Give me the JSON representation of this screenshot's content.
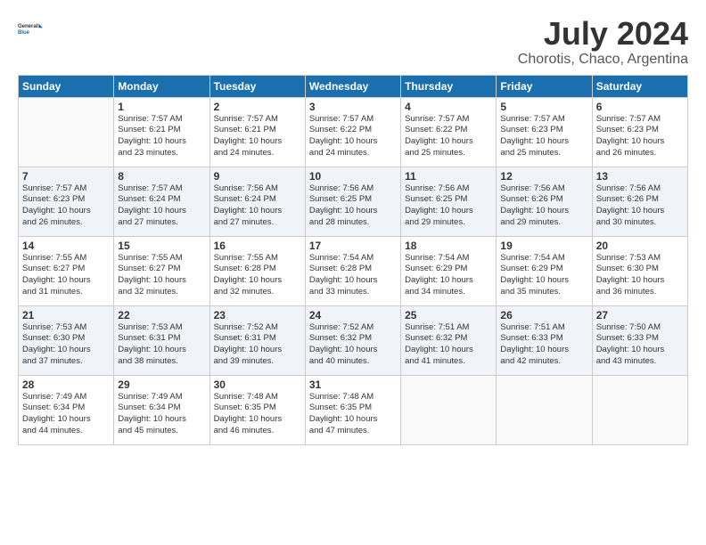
{
  "logo": {
    "line1": "General",
    "line2": "Blue"
  },
  "title": "July 2024",
  "subtitle": "Chorotis, Chaco, Argentina",
  "days_header": [
    "Sunday",
    "Monday",
    "Tuesday",
    "Wednesday",
    "Thursday",
    "Friday",
    "Saturday"
  ],
  "weeks": [
    [
      {
        "day": "",
        "sunrise": "",
        "sunset": "",
        "daylight": ""
      },
      {
        "day": "1",
        "sunrise": "Sunrise: 7:57 AM",
        "sunset": "Sunset: 6:21 PM",
        "daylight": "Daylight: 10 hours and 23 minutes."
      },
      {
        "day": "2",
        "sunrise": "Sunrise: 7:57 AM",
        "sunset": "Sunset: 6:21 PM",
        "daylight": "Daylight: 10 hours and 24 minutes."
      },
      {
        "day": "3",
        "sunrise": "Sunrise: 7:57 AM",
        "sunset": "Sunset: 6:22 PM",
        "daylight": "Daylight: 10 hours and 24 minutes."
      },
      {
        "day": "4",
        "sunrise": "Sunrise: 7:57 AM",
        "sunset": "Sunset: 6:22 PM",
        "daylight": "Daylight: 10 hours and 25 minutes."
      },
      {
        "day": "5",
        "sunrise": "Sunrise: 7:57 AM",
        "sunset": "Sunset: 6:23 PM",
        "daylight": "Daylight: 10 hours and 25 minutes."
      },
      {
        "day": "6",
        "sunrise": "Sunrise: 7:57 AM",
        "sunset": "Sunset: 6:23 PM",
        "daylight": "Daylight: 10 hours and 26 minutes."
      }
    ],
    [
      {
        "day": "7",
        "sunrise": "Sunrise: 7:57 AM",
        "sunset": "Sunset: 6:23 PM",
        "daylight": "Daylight: 10 hours and 26 minutes."
      },
      {
        "day": "8",
        "sunrise": "Sunrise: 7:57 AM",
        "sunset": "Sunset: 6:24 PM",
        "daylight": "Daylight: 10 hours and 27 minutes."
      },
      {
        "day": "9",
        "sunrise": "Sunrise: 7:56 AM",
        "sunset": "Sunset: 6:24 PM",
        "daylight": "Daylight: 10 hours and 27 minutes."
      },
      {
        "day": "10",
        "sunrise": "Sunrise: 7:56 AM",
        "sunset": "Sunset: 6:25 PM",
        "daylight": "Daylight: 10 hours and 28 minutes."
      },
      {
        "day": "11",
        "sunrise": "Sunrise: 7:56 AM",
        "sunset": "Sunset: 6:25 PM",
        "daylight": "Daylight: 10 hours and 29 minutes."
      },
      {
        "day": "12",
        "sunrise": "Sunrise: 7:56 AM",
        "sunset": "Sunset: 6:26 PM",
        "daylight": "Daylight: 10 hours and 29 minutes."
      },
      {
        "day": "13",
        "sunrise": "Sunrise: 7:56 AM",
        "sunset": "Sunset: 6:26 PM",
        "daylight": "Daylight: 10 hours and 30 minutes."
      }
    ],
    [
      {
        "day": "14",
        "sunrise": "Sunrise: 7:55 AM",
        "sunset": "Sunset: 6:27 PM",
        "daylight": "Daylight: 10 hours and 31 minutes."
      },
      {
        "day": "15",
        "sunrise": "Sunrise: 7:55 AM",
        "sunset": "Sunset: 6:27 PM",
        "daylight": "Daylight: 10 hours and 32 minutes."
      },
      {
        "day": "16",
        "sunrise": "Sunrise: 7:55 AM",
        "sunset": "Sunset: 6:28 PM",
        "daylight": "Daylight: 10 hours and 32 minutes."
      },
      {
        "day": "17",
        "sunrise": "Sunrise: 7:54 AM",
        "sunset": "Sunset: 6:28 PM",
        "daylight": "Daylight: 10 hours and 33 minutes."
      },
      {
        "day": "18",
        "sunrise": "Sunrise: 7:54 AM",
        "sunset": "Sunset: 6:29 PM",
        "daylight": "Daylight: 10 hours and 34 minutes."
      },
      {
        "day": "19",
        "sunrise": "Sunrise: 7:54 AM",
        "sunset": "Sunset: 6:29 PM",
        "daylight": "Daylight: 10 hours and 35 minutes."
      },
      {
        "day": "20",
        "sunrise": "Sunrise: 7:53 AM",
        "sunset": "Sunset: 6:30 PM",
        "daylight": "Daylight: 10 hours and 36 minutes."
      }
    ],
    [
      {
        "day": "21",
        "sunrise": "Sunrise: 7:53 AM",
        "sunset": "Sunset: 6:30 PM",
        "daylight": "Daylight: 10 hours and 37 minutes."
      },
      {
        "day": "22",
        "sunrise": "Sunrise: 7:53 AM",
        "sunset": "Sunset: 6:31 PM",
        "daylight": "Daylight: 10 hours and 38 minutes."
      },
      {
        "day": "23",
        "sunrise": "Sunrise: 7:52 AM",
        "sunset": "Sunset: 6:31 PM",
        "daylight": "Daylight: 10 hours and 39 minutes."
      },
      {
        "day": "24",
        "sunrise": "Sunrise: 7:52 AM",
        "sunset": "Sunset: 6:32 PM",
        "daylight": "Daylight: 10 hours and 40 minutes."
      },
      {
        "day": "25",
        "sunrise": "Sunrise: 7:51 AM",
        "sunset": "Sunset: 6:32 PM",
        "daylight": "Daylight: 10 hours and 41 minutes."
      },
      {
        "day": "26",
        "sunrise": "Sunrise: 7:51 AM",
        "sunset": "Sunset: 6:33 PM",
        "daylight": "Daylight: 10 hours and 42 minutes."
      },
      {
        "day": "27",
        "sunrise": "Sunrise: 7:50 AM",
        "sunset": "Sunset: 6:33 PM",
        "daylight": "Daylight: 10 hours and 43 minutes."
      }
    ],
    [
      {
        "day": "28",
        "sunrise": "Sunrise: 7:49 AM",
        "sunset": "Sunset: 6:34 PM",
        "daylight": "Daylight: 10 hours and 44 minutes."
      },
      {
        "day": "29",
        "sunrise": "Sunrise: 7:49 AM",
        "sunset": "Sunset: 6:34 PM",
        "daylight": "Daylight: 10 hours and 45 minutes."
      },
      {
        "day": "30",
        "sunrise": "Sunrise: 7:48 AM",
        "sunset": "Sunset: 6:35 PM",
        "daylight": "Daylight: 10 hours and 46 minutes."
      },
      {
        "day": "31",
        "sunrise": "Sunrise: 7:48 AM",
        "sunset": "Sunset: 6:35 PM",
        "daylight": "Daylight: 10 hours and 47 minutes."
      },
      {
        "day": "",
        "sunrise": "",
        "sunset": "",
        "daylight": ""
      },
      {
        "day": "",
        "sunrise": "",
        "sunset": "",
        "daylight": ""
      },
      {
        "day": "",
        "sunrise": "",
        "sunset": "",
        "daylight": ""
      }
    ]
  ]
}
